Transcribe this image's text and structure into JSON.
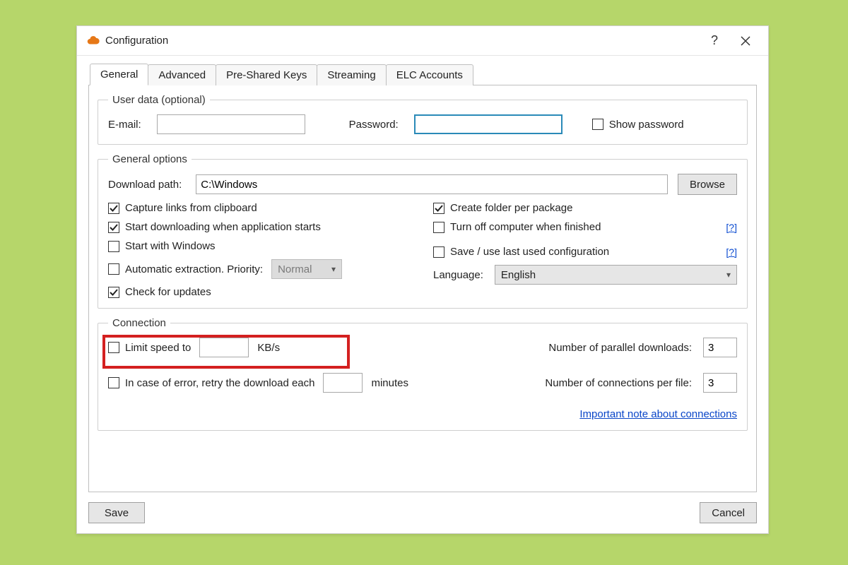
{
  "window": {
    "title": "Configuration",
    "help_label": "?",
    "close_label": "Close"
  },
  "tabs": [
    {
      "label": "General",
      "active": true
    },
    {
      "label": "Advanced",
      "active": false
    },
    {
      "label": "Pre-Shared Keys",
      "active": false
    },
    {
      "label": "Streaming",
      "active": false
    },
    {
      "label": "ELC Accounts",
      "active": false
    }
  ],
  "user_data": {
    "legend": "User data (optional)",
    "email_label": "E-mail:",
    "email_value": "",
    "password_label": "Password:",
    "password_value": "",
    "show_password_label": "Show password",
    "show_password_checked": false
  },
  "general_options": {
    "legend": "General options",
    "download_path_label": "Download path:",
    "download_path_value": "C:\\Windows",
    "browse_label": "Browse",
    "capture_links": {
      "label": "Capture links from clipboard",
      "checked": true
    },
    "start_dl_on_start": {
      "label": "Start downloading when application starts",
      "checked": true
    },
    "start_with_windows": {
      "label": "Start with Windows",
      "checked": false
    },
    "auto_extract": {
      "label": "Automatic extraction. Priority:",
      "checked": false,
      "priority": "Normal"
    },
    "check_updates": {
      "label": "Check for updates",
      "checked": true
    },
    "create_folder": {
      "label": "Create folder per package",
      "checked": true
    },
    "turnoff": {
      "label": "Turn off computer when finished",
      "checked": false,
      "help": "[?]"
    },
    "save_last_cfg": {
      "label": "Save / use last used configuration",
      "checked": false,
      "help": "[?]"
    },
    "language_label": "Language:",
    "language_value": "English"
  },
  "connection": {
    "legend": "Connection",
    "limit_speed": {
      "label": "Limit speed to",
      "checked": false,
      "value": "",
      "unit": "KB/s"
    },
    "retry": {
      "label": "In case of error, retry the download each",
      "checked": false,
      "value": "",
      "unit": "minutes"
    },
    "parallel_label": "Number of parallel downloads:",
    "parallel_value": "3",
    "conn_per_file_label": "Number of connections per file:",
    "conn_per_file_value": "3",
    "note_link": "Important note about connections"
  },
  "footer": {
    "save_label": "Save",
    "cancel_label": "Cancel"
  }
}
